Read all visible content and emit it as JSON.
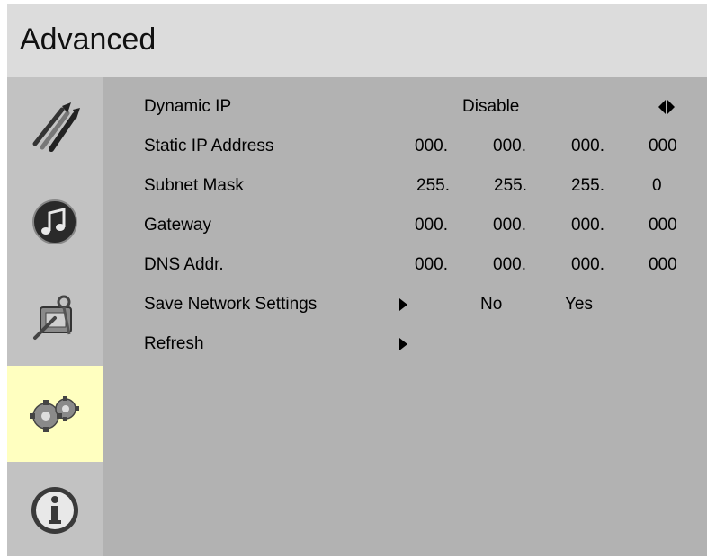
{
  "header": {
    "title": "Advanced"
  },
  "sidebar": {
    "items": [
      {
        "icon": "brushes-icon",
        "selected": false
      },
      {
        "icon": "music-note-icon",
        "selected": false
      },
      {
        "icon": "tools-settings-icon",
        "selected": false
      },
      {
        "icon": "gears-icon",
        "selected": true
      },
      {
        "icon": "info-icon",
        "selected": false
      }
    ],
    "selected_color": "#ffffc0"
  },
  "settings": {
    "dynamic_ip": {
      "label": "Dynamic IP",
      "value": "Disable"
    },
    "static_ip": {
      "label": "Static IP Address",
      "octets": [
        "000.",
        "000.",
        "000.",
        "000"
      ]
    },
    "subnet_mask": {
      "label": "Subnet Mask",
      "octets": [
        "255.",
        "255.",
        "255.",
        "0"
      ]
    },
    "gateway": {
      "label": "Gateway",
      "octets": [
        "000.",
        "000.",
        "000.",
        "000"
      ]
    },
    "dns": {
      "label": "DNS Addr.",
      "octets": [
        "000.",
        "000.",
        "000.",
        "000"
      ]
    },
    "save_network": {
      "label": "Save Network Settings",
      "option_no": "No",
      "option_yes": "Yes"
    },
    "refresh": {
      "label": "Refresh"
    }
  }
}
